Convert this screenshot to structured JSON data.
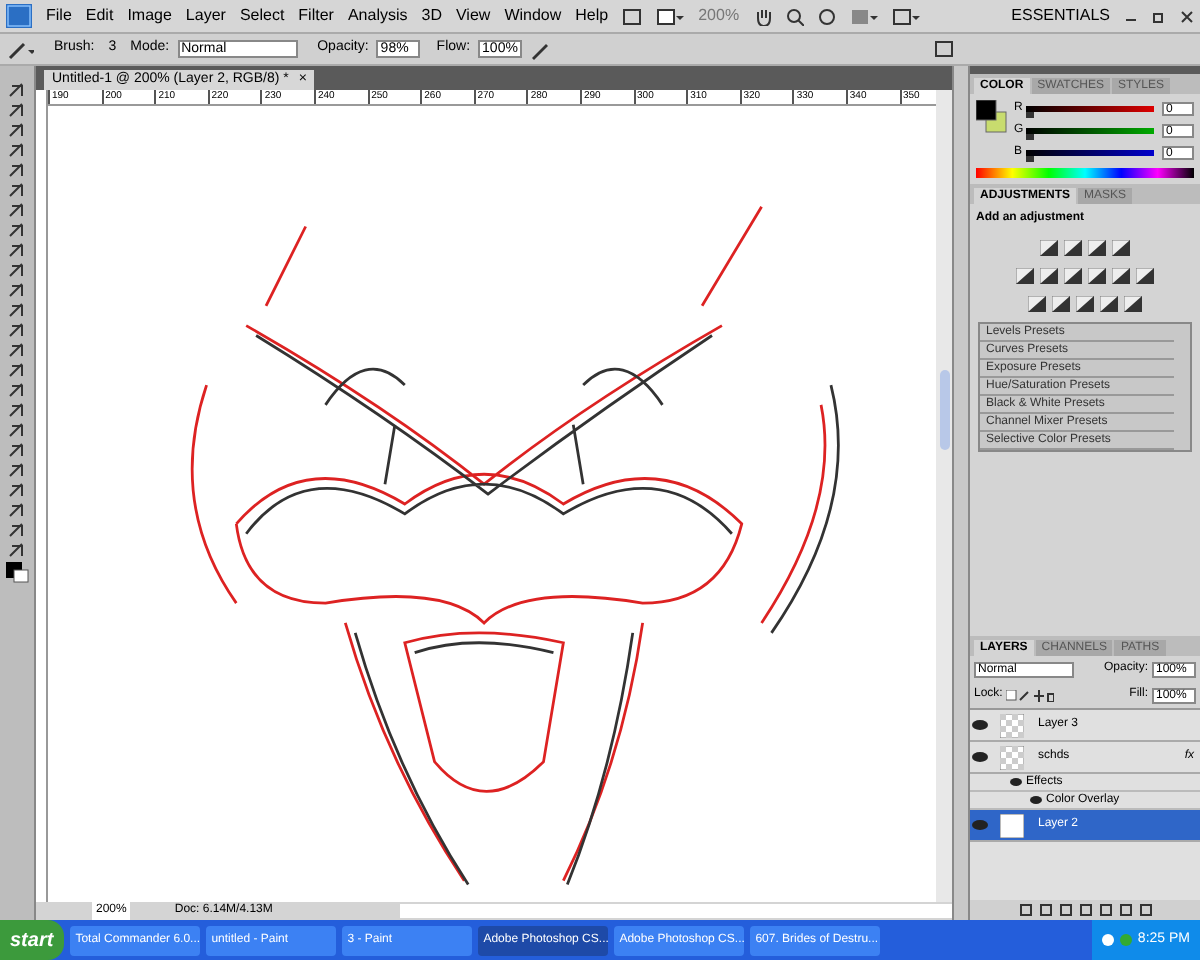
{
  "menu": [
    "File",
    "Edit",
    "Image",
    "Layer",
    "Select",
    "Filter",
    "Analysis",
    "3D",
    "View",
    "Window",
    "Help"
  ],
  "app_bar": {
    "zoom": "200%",
    "workspace": "ESSENTIALS"
  },
  "options": {
    "brush_label": "Brush:",
    "brush_size": "3",
    "mode_label": "Mode:",
    "mode": "Normal",
    "opacity_label": "Opacity:",
    "opacity": "98%",
    "flow_label": "Flow:",
    "flow": "100%"
  },
  "document": {
    "tab": "Untitled-1 @ 200% (Layer 2, RGB/8) *",
    "close": "×",
    "ruler_labels": [
      "190",
      "200",
      "210",
      "220",
      "230",
      "240",
      "250",
      "260",
      "270",
      "280",
      "290",
      "300",
      "310",
      "320",
      "330",
      "340",
      "350"
    ]
  },
  "color_panel": {
    "tabs": [
      {
        "label": "COLOR",
        "selected": true
      },
      {
        "label": "SWATCHES",
        "selected": false
      },
      {
        "label": "STYLES",
        "selected": false
      }
    ],
    "sliders": [
      {
        "label": "R",
        "value": "0",
        "level": 0
      },
      {
        "label": "G",
        "value": "0",
        "level": 0
      },
      {
        "label": "B",
        "value": "0",
        "level": 0
      }
    ]
  },
  "adjustments_panel": {
    "tabs": [
      {
        "label": "ADJUSTMENTS",
        "selected": true
      },
      {
        "label": "MASKS",
        "selected": false
      }
    ],
    "heading": "Add an adjustment",
    "presets": [
      "Levels Presets",
      "Curves Presets",
      "Exposure Presets",
      "Hue/Saturation Presets",
      "Black & White Presets",
      "Channel Mixer Presets",
      "Selective Color Presets"
    ]
  },
  "layers_panel": {
    "tabs": [
      {
        "label": "LAYERS",
        "selected": true
      },
      {
        "label": "CHANNELS",
        "selected": false
      },
      {
        "label": "PATHS",
        "selected": false
      }
    ],
    "blend_mode": "Normal",
    "opacity_label": "Opacity:",
    "opacity": "100%",
    "lock_label": "Lock:",
    "fill_label": "Fill:",
    "fill": "100%",
    "layers": [
      {
        "name": "Layer 3",
        "kind": "transparent",
        "selected": false
      },
      {
        "name": "schds",
        "kind": "transparent",
        "selected": false,
        "fx": "fx",
        "effects": [
          "Effects",
          "Color Overlay"
        ]
      },
      {
        "name": "Layer 2",
        "kind": "white",
        "selected": true
      }
    ]
  },
  "status_bar": {
    "zoom": "200%",
    "doc": "Doc: 6.14M/4.13M"
  },
  "taskbar": {
    "start": "start",
    "tasks": [
      {
        "label": "Total Commander 6.0...",
        "selected": false
      },
      {
        "label": "untitled - Paint",
        "selected": false
      },
      {
        "label": "3 - Paint",
        "selected": false
      },
      {
        "label": "Adobe Photoshop CS...",
        "selected": true
      },
      {
        "label": "Adobe Photoshop CS...",
        "selected": false
      },
      {
        "label": "607. Brides of Destru...",
        "selected": false
      }
    ],
    "clock": "8:25 PM"
  }
}
